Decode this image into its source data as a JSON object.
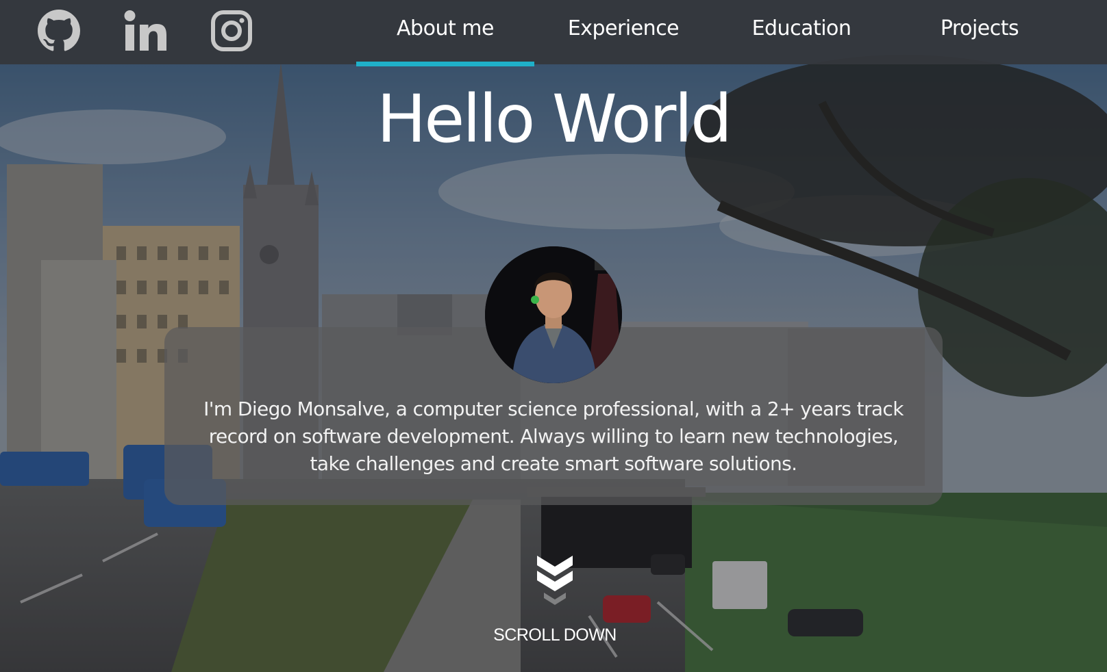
{
  "social": {
    "github_label": "GitHub",
    "linkedin_label": "LinkedIn",
    "instagram_label": "Instagram",
    "icon_color": "#c8c8c8"
  },
  "nav": {
    "items": [
      {
        "label": "About me",
        "active": true
      },
      {
        "label": "Experience",
        "active": false
      },
      {
        "label": "Education",
        "active": false
      },
      {
        "label": "Projects",
        "active": false
      }
    ],
    "accent_color": "#1fb0c9"
  },
  "hero": {
    "title": "Hello World"
  },
  "about": {
    "text": "I'm Diego Monsalve, a computer science professional, with a 2+ years track record on software development. Always willing to learn new technologies, take challenges and create smart software solutions."
  },
  "scroll": {
    "label": "SCROLL DOWN",
    "icon": "double-chevron-down-icon"
  }
}
